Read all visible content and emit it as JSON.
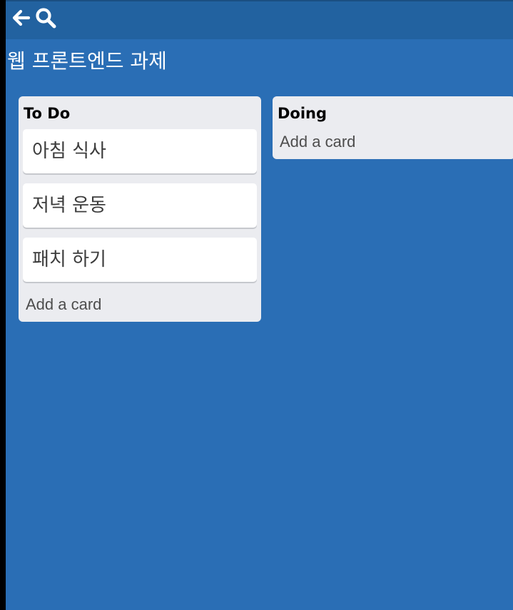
{
  "header": {
    "back_icon": "back-arrow-icon",
    "search_icon": "search-icon"
  },
  "board": {
    "title": "웹 프론트엔드 과제"
  },
  "lists": [
    {
      "title": "To Do",
      "cards": [
        "아침 식사",
        "저녁 운동",
        "패치 하기"
      ],
      "add_label": "Add a card"
    },
    {
      "title": "Doing",
      "cards": [],
      "add_label": "Add a card"
    }
  ],
  "colors": {
    "board_background": "#2a6eb5",
    "header_background": "#2262a0",
    "list_background": "#ebecf0",
    "card_background": "#ffffff"
  }
}
